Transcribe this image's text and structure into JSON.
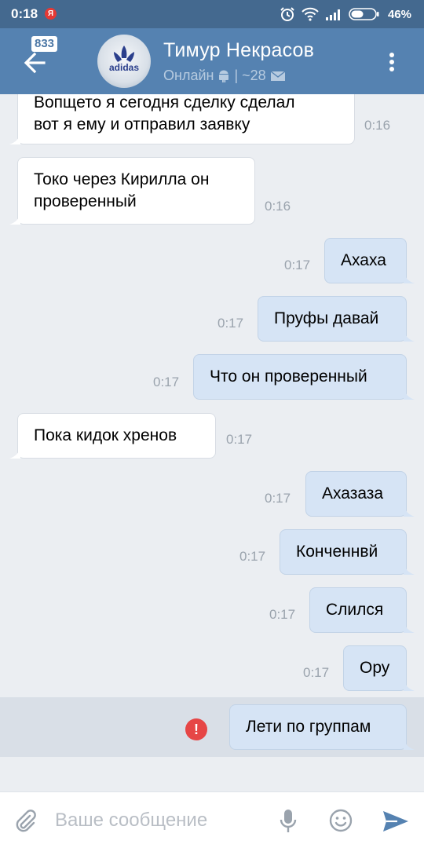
{
  "status_bar": {
    "time": "0:18",
    "yandex_badge": "Я",
    "battery_percent": "46%",
    "icons": [
      "alarm-icon",
      "wifi-icon",
      "signal-icon",
      "battery-icon"
    ]
  },
  "header": {
    "unread_count": "833",
    "contact_name": "Тимур Некрасов",
    "status": "Онлайн",
    "status_suffix": "| ~28",
    "avatar_text": "adidas",
    "colors": {
      "header": "#5582b1",
      "status_bar": "#44698f"
    }
  },
  "messages": [
    {
      "direction": "in",
      "text_line1": "Вопщето я сегодня сделку сделал",
      "text_line2": "вот я ему и отправил заявку",
      "time": "0:16"
    },
    {
      "direction": "in",
      "text_line1": "Токо через Кирилла он",
      "text_line2": "проверенный",
      "time": "0:16"
    },
    {
      "direction": "out",
      "text": "Ахаха",
      "time": "0:17"
    },
    {
      "direction": "out",
      "text": "Пруфы давай",
      "time": "0:17"
    },
    {
      "direction": "out",
      "text": "Что он проверенный",
      "time": "0:17"
    },
    {
      "direction": "in",
      "text": "Пока кидок хренов",
      "time": "0:17"
    },
    {
      "direction": "out",
      "text": "Ахазаза",
      "time": "0:17"
    },
    {
      "direction": "out",
      "text": "Конченнвй",
      "time": "0:17"
    },
    {
      "direction": "out",
      "text": "Слился",
      "time": "0:17"
    },
    {
      "direction": "out",
      "text": "Ору",
      "time": "0:17"
    },
    {
      "direction": "out",
      "text": "Лети по группам",
      "status": "failed",
      "error_mark": "!"
    }
  ],
  "composer": {
    "placeholder": "Ваше сообщение",
    "value": ""
  }
}
